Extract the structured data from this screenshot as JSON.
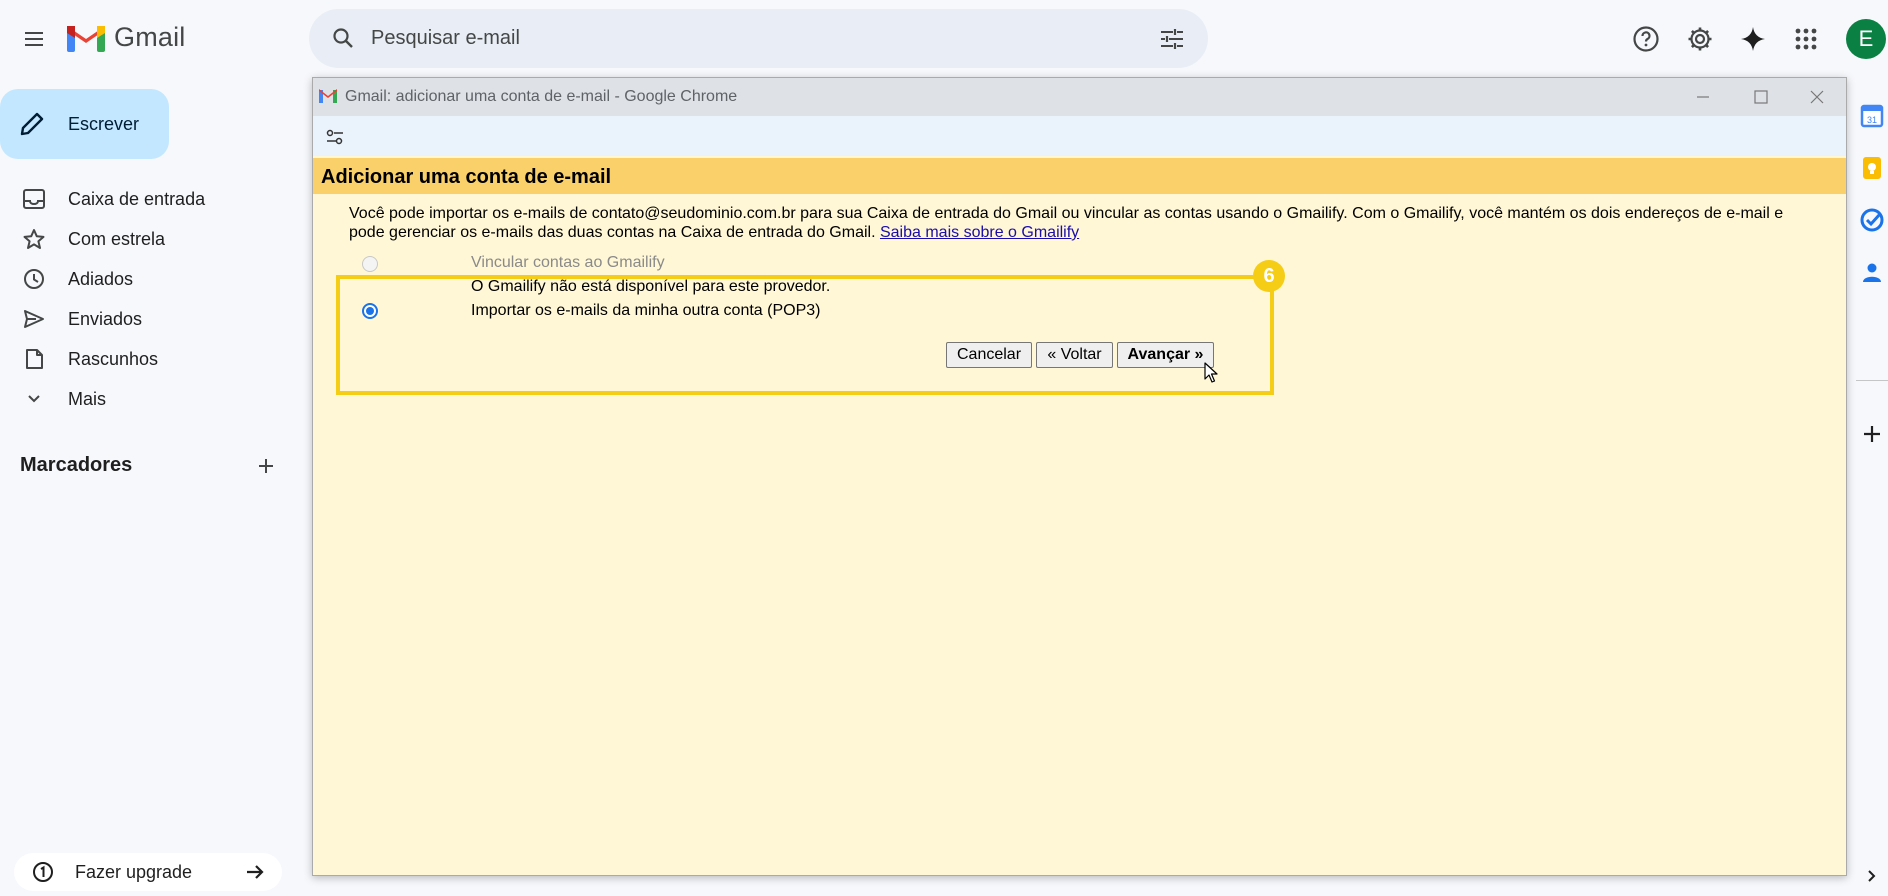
{
  "header": {
    "app_name": "Gmail",
    "search_placeholder": "Pesquisar e-mail",
    "avatar_letter": "E"
  },
  "sidebar": {
    "compose_label": "Escrever",
    "items": [
      {
        "label": "Caixa de entrada",
        "icon": "inbox-icon"
      },
      {
        "label": "Com estrela",
        "icon": "star-icon"
      },
      {
        "label": "Adiados",
        "icon": "clock-icon"
      },
      {
        "label": "Enviados",
        "icon": "send-icon"
      },
      {
        "label": "Rascunhos",
        "icon": "draft-icon"
      },
      {
        "label": "Mais",
        "icon": "chevron-down-icon"
      }
    ],
    "labels_title": "Marcadores",
    "upgrade_label": "Fazer upgrade"
  },
  "popup": {
    "window_title": "Gmail: adicionar uma conta de e-mail - Google Chrome",
    "dialog_title": "Adicionar uma conta de e-mail",
    "intro_text": "Você pode importar os e-mails de contato@seudominio.com.br para sua Caixa de entrada do Gmail ou vincular as contas usando o Gmailify. Com o Gmailify, você mantém os dois endereços de e-mail e pode gerenciar os e-mails das duas contas na Caixa de entrada do Gmail.",
    "intro_link": "Saiba mais sobre o Gmailify",
    "option_gmailify": "Vincular contas ao Gmailify",
    "gmailify_unavailable": "O Gmailify não está disponível para este provedor.",
    "option_pop3": "Importar os e-mails da minha outra conta (POP3)",
    "cancel_label": "Cancelar",
    "back_label": "« Voltar",
    "next_label": "Avançar »"
  },
  "annotation": {
    "step_number": "6",
    "highlight_color": "#f5cd16"
  },
  "colors": {
    "compose_bg": "#c2e7ff",
    "dialog_header_bg": "#f9d06a",
    "dialog_body_bg": "#fff7d6",
    "search_bg": "#e9eef6"
  }
}
